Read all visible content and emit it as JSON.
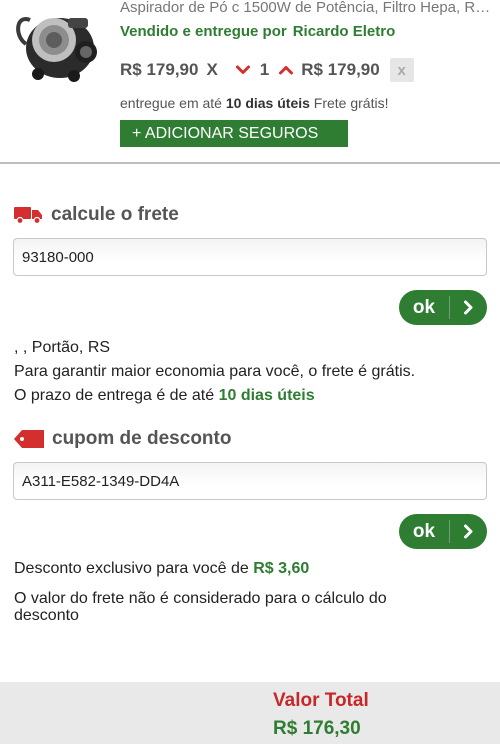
{
  "product": {
    "name": "Aspirador de Pó c 1500W de Potência, Filtro Hepa, Ro...",
    "seller_prefix": "Vendido e entregue por",
    "seller_name": "Ricardo Eletro",
    "unit_price": "R$ 179,90",
    "times": "X",
    "quantity": "1",
    "total_price": "R$ 179,90",
    "remove_label": "x",
    "delivery_prefix": "entregue em até",
    "delivery_days": "10 dias úteis",
    "delivery_suffix": "Frete grátis!",
    "add_insurance_label": "+ ADICIONAR SEGUROS",
    "image_icon": "vacuum-cleaner-image"
  },
  "shipping": {
    "title": "calcule o frete",
    "icon": "truck-icon",
    "zip_value": "93180-000",
    "ok_label": "ok",
    "address": ", , Portão, RS",
    "free_message": "Para garantir maior economia para você, o frete é grátis.",
    "deadline_prefix": "O prazo de entrega é de até",
    "deadline_days": "10 dias úteis"
  },
  "coupon": {
    "title": "cupom de desconto",
    "icon": "tag-icon",
    "code_value": "A311-E582-1349-DD4A",
    "ok_label": "ok",
    "discount_prefix": "Desconto exclusivo para você de",
    "discount_value": "R$ 3,60",
    "note_line1": "O valor do frete não é considerado para o cálculo do",
    "note_line2": "desconto"
  },
  "summary": {
    "total_label": "Valor Total",
    "total_value": "R$ 176,30"
  },
  "colors": {
    "green": "#2e7d32",
    "red": "#c62828",
    "gray_text": "#555555"
  }
}
